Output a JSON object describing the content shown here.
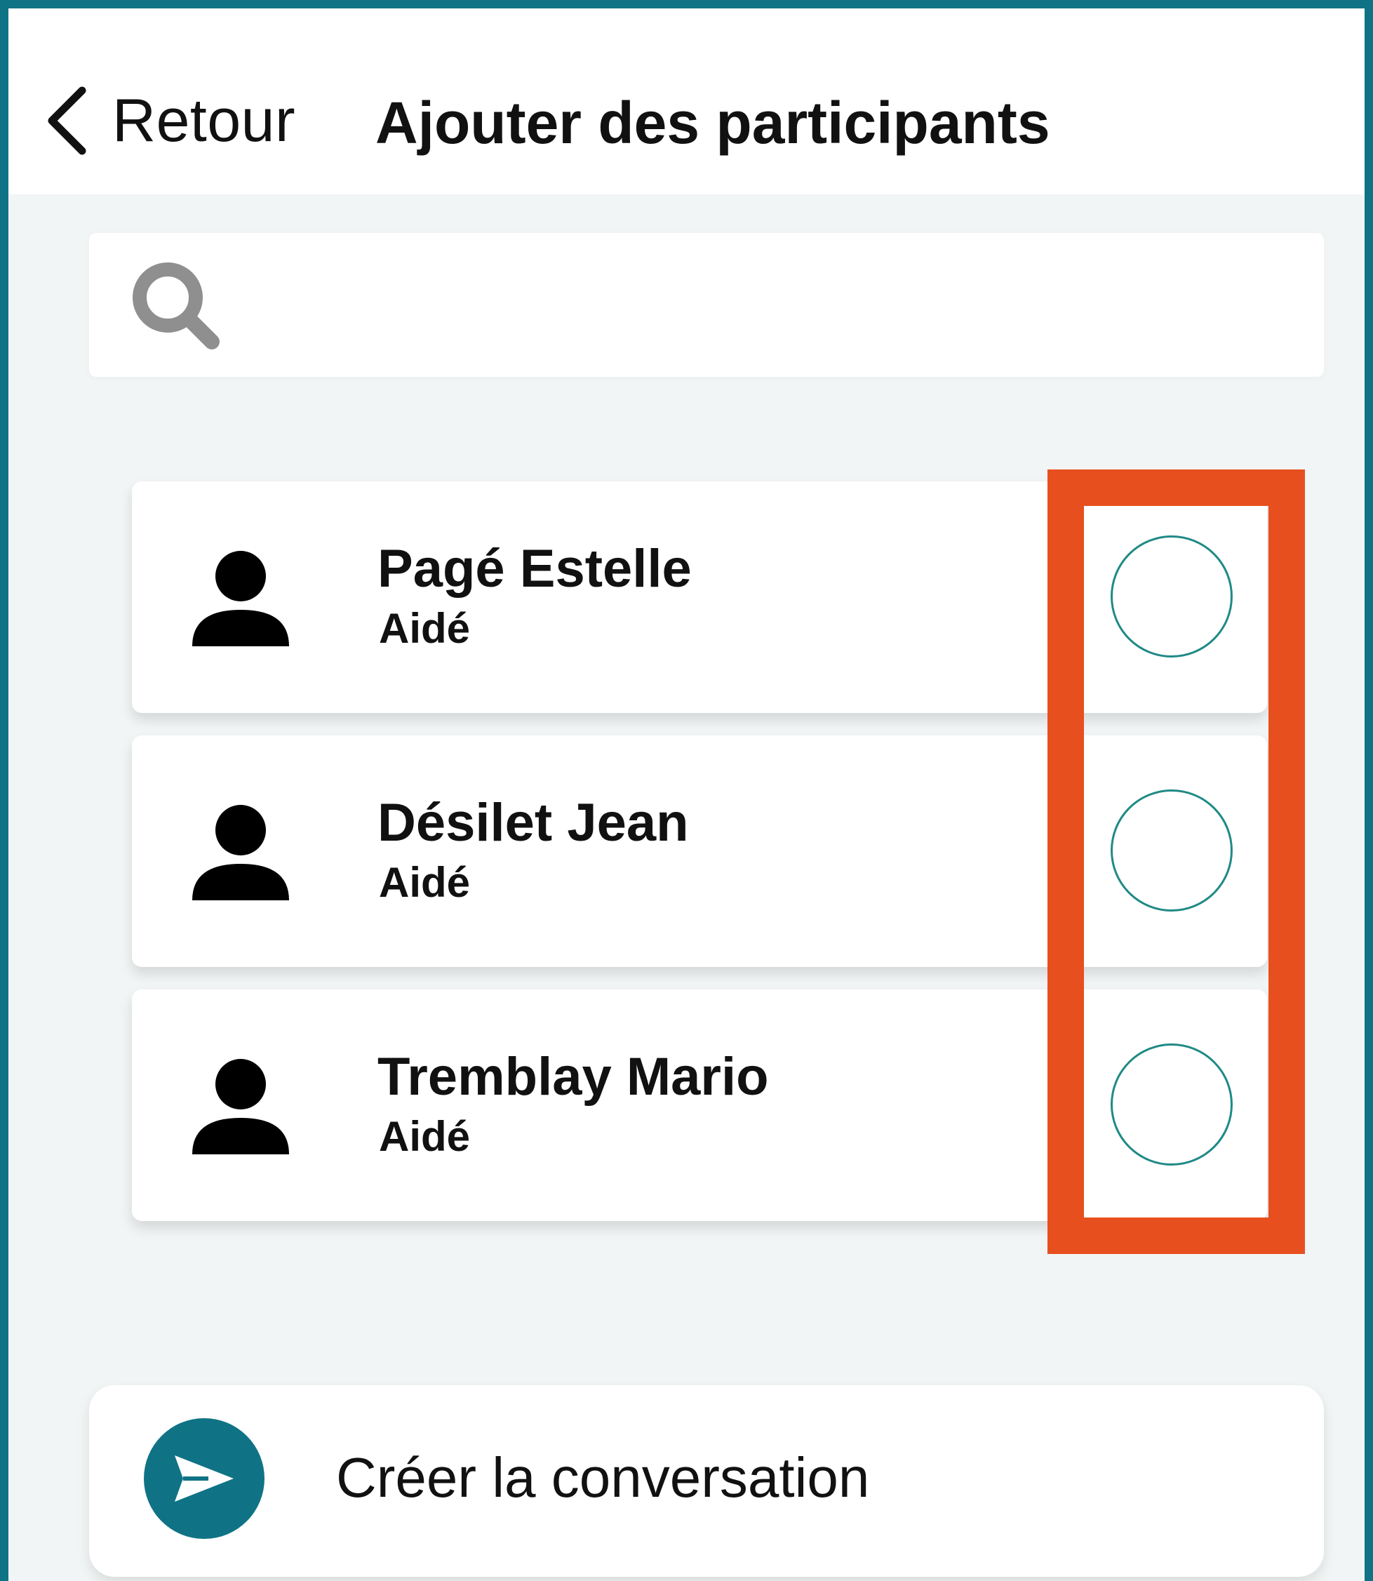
{
  "header": {
    "back_label": "Retour",
    "title": "Ajouter des participants"
  },
  "search": {
    "value": "",
    "placeholder": ""
  },
  "participants": [
    {
      "name": "Pagé Estelle",
      "role": "Aidé",
      "selected": false
    },
    {
      "name": "Désilet Jean",
      "role": "Aidé",
      "selected": false
    },
    {
      "name": "Tremblay Mario",
      "role": "Aidé",
      "selected": false
    }
  ],
  "create_button": {
    "label": "Créer la conversation",
    "icon": "send-icon"
  },
  "colors": {
    "accent": "#0f7385",
    "checkbox_border": "#1f8a86",
    "highlight": "#e84f1f",
    "background": "#f2f5f5"
  }
}
